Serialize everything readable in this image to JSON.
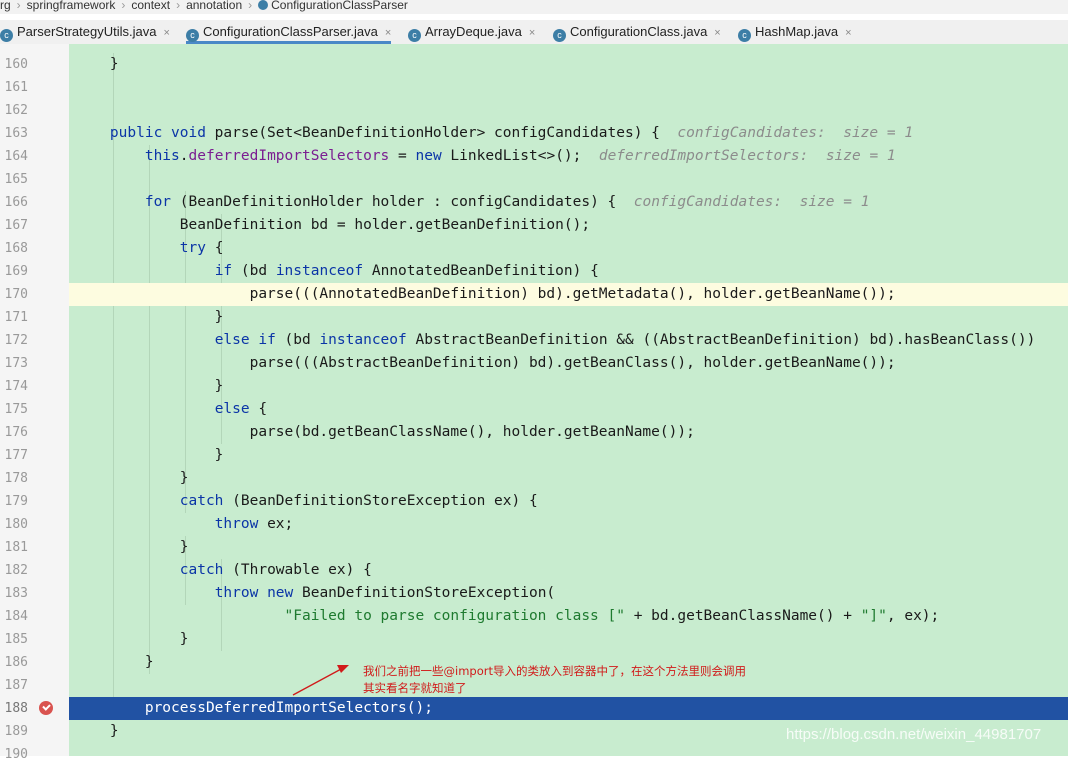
{
  "breadcrumb": [
    "rg",
    "springframework",
    "context",
    "annotation",
    "ConfigurationClassParser"
  ],
  "tabs": [
    {
      "label": "ParserStrategyUtils.java",
      "active": false
    },
    {
      "label": "ConfigurationClassParser.java",
      "active": true
    },
    {
      "label": "ArrayDeque.java",
      "active": false
    },
    {
      "label": "ConfigurationClass.java",
      "active": false
    },
    {
      "label": "HashMap.java",
      "active": false
    }
  ],
  "tab_icon_glyph": "c",
  "tab_close_glyph": "×",
  "lines": [
    {
      "num": "160",
      "segs": [
        {
          "t": "    }"
        }
      ]
    },
    {
      "num": "161",
      "segs": []
    },
    {
      "num": "162",
      "segs": []
    },
    {
      "num": "163",
      "segs": [
        {
          "t": "    "
        },
        {
          "t": "public void",
          "c": "kw"
        },
        {
          "t": " parse(Set<BeanDefinitionHolder> configCandidates) {  "
        },
        {
          "t": "configCandidates:  size = 1",
          "c": "hint"
        }
      ]
    },
    {
      "num": "164",
      "segs": [
        {
          "t": "        "
        },
        {
          "t": "this",
          "c": "kw"
        },
        {
          "t": "."
        },
        {
          "t": "deferredImportSelectors",
          "c": "fld"
        },
        {
          "t": " = "
        },
        {
          "t": "new",
          "c": "kw"
        },
        {
          "t": " LinkedList<>();  "
        },
        {
          "t": "deferredImportSelectors:  size = 1",
          "c": "hint"
        }
      ]
    },
    {
      "num": "165",
      "segs": []
    },
    {
      "num": "166",
      "segs": [
        {
          "t": "        "
        },
        {
          "t": "for",
          "c": "kw"
        },
        {
          "t": " (BeanDefinitionHolder holder : configCandidates) {  "
        },
        {
          "t": "configCandidates:  size = 1",
          "c": "hint"
        }
      ]
    },
    {
      "num": "167",
      "segs": [
        {
          "t": "            BeanDefinition bd = holder.getBeanDefinition();"
        }
      ]
    },
    {
      "num": "168",
      "segs": [
        {
          "t": "            "
        },
        {
          "t": "try",
          "c": "kw"
        },
        {
          "t": " {"
        }
      ]
    },
    {
      "num": "169",
      "segs": [
        {
          "t": "                "
        },
        {
          "t": "if",
          "c": "kw"
        },
        {
          "t": " (bd "
        },
        {
          "t": "instanceof",
          "c": "kw"
        },
        {
          "t": " AnnotatedBeanDefinition) {"
        }
      ]
    },
    {
      "num": "170",
      "segs": [
        {
          "t": "                    parse(((AnnotatedBeanDefinition) bd).getMetadata(), holder.getBeanName());"
        }
      ],
      "current": true
    },
    {
      "num": "171",
      "segs": [
        {
          "t": "                }"
        }
      ]
    },
    {
      "num": "172",
      "segs": [
        {
          "t": "                "
        },
        {
          "t": "else if",
          "c": "kw"
        },
        {
          "t": " (bd "
        },
        {
          "t": "instanceof",
          "c": "kw"
        },
        {
          "t": " AbstractBeanDefinition && ((AbstractBeanDefinition) bd).hasBeanClass())"
        }
      ]
    },
    {
      "num": "173",
      "segs": [
        {
          "t": "                    parse(((AbstractBeanDefinition) bd).getBeanClass(), holder.getBeanName());"
        }
      ]
    },
    {
      "num": "174",
      "segs": [
        {
          "t": "                }"
        }
      ]
    },
    {
      "num": "175",
      "segs": [
        {
          "t": "                "
        },
        {
          "t": "else",
          "c": "kw"
        },
        {
          "t": " {"
        }
      ]
    },
    {
      "num": "176",
      "segs": [
        {
          "t": "                    parse(bd.getBeanClassName(), holder.getBeanName());"
        }
      ]
    },
    {
      "num": "177",
      "segs": [
        {
          "t": "                }"
        }
      ]
    },
    {
      "num": "178",
      "segs": [
        {
          "t": "            }"
        }
      ]
    },
    {
      "num": "179",
      "segs": [
        {
          "t": "            "
        },
        {
          "t": "catch",
          "c": "kw"
        },
        {
          "t": " (BeanDefinitionStoreException ex) {"
        }
      ]
    },
    {
      "num": "180",
      "segs": [
        {
          "t": "                "
        },
        {
          "t": "throw",
          "c": "kw"
        },
        {
          "t": " ex;"
        }
      ]
    },
    {
      "num": "181",
      "segs": [
        {
          "t": "            }"
        }
      ]
    },
    {
      "num": "182",
      "segs": [
        {
          "t": "            "
        },
        {
          "t": "catch",
          "c": "kw"
        },
        {
          "t": " (Throwable ex) {"
        }
      ]
    },
    {
      "num": "183",
      "segs": [
        {
          "t": "                "
        },
        {
          "t": "throw new",
          "c": "kw"
        },
        {
          "t": " BeanDefinitionStoreException("
        }
      ]
    },
    {
      "num": "184",
      "segs": [
        {
          "t": "                        "
        },
        {
          "t": "\"Failed to parse configuration class [\"",
          "c": "str"
        },
        {
          "t": " + bd.getBeanClassName() + "
        },
        {
          "t": "\"]\"",
          "c": "str"
        },
        {
          "t": ", ex);"
        }
      ]
    },
    {
      "num": "185",
      "segs": [
        {
          "t": "            }"
        }
      ]
    },
    {
      "num": "186",
      "segs": [
        {
          "t": "        }"
        }
      ]
    },
    {
      "num": "187",
      "segs": []
    },
    {
      "num": "188",
      "segs": [
        {
          "t": "        processDeferredImportSelectors();"
        }
      ],
      "selected": true,
      "breakpoint": true
    },
    {
      "num": "189",
      "segs": [
        {
          "t": "    }"
        }
      ]
    },
    {
      "num": "190",
      "segs": []
    }
  ],
  "annotation": {
    "lines": [
      "我们之前把一些@import导入的类放入到容器中了，在这个方法里则会调用",
      "其实看名字就知道了"
    ],
    "color": "#d11a1a"
  },
  "watermark": "https://blog.csdn.net/weixin_44981707",
  "colors": {
    "code_bg": "#c8eccf",
    "selection": "#2152a3",
    "keyword": "#0b35a7",
    "field": "#7a1e91",
    "string": "#1e7a2f"
  }
}
